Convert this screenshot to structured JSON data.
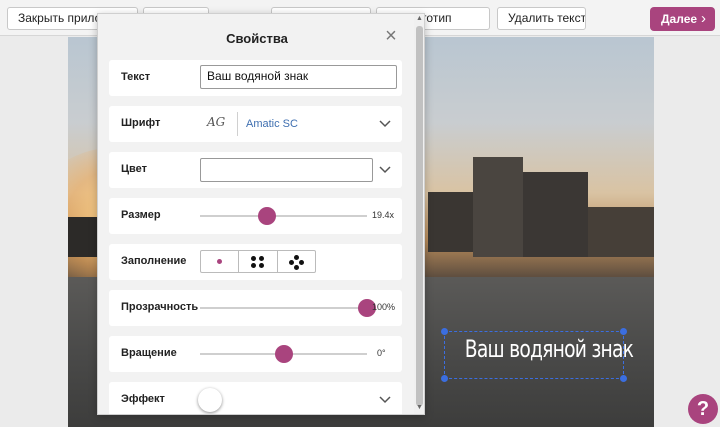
{
  "toolbar": {
    "close_app_label": "Закрыть прилож",
    "hidden_button_2": "",
    "hidden_button_3": "",
    "add_logo_label": "ать логотип",
    "delete_text_label": "Удалить текст",
    "next_label": "Далее"
  },
  "watermark": {
    "text": "Ваш водяной знак"
  },
  "panel": {
    "title": "Свойства",
    "text": {
      "label": "Текст",
      "value": "Ваш водяной знак"
    },
    "font": {
      "label": "Шрифт",
      "preview": "AG",
      "name": "Amatic SC"
    },
    "color": {
      "label": "Цвет"
    },
    "size": {
      "label": "Размер",
      "value_text": "19.4x",
      "fraction": 0.4
    },
    "fill": {
      "label": "Заполнение"
    },
    "opacity": {
      "label": "Прозрачность",
      "value_text": "100%",
      "fraction": 1.0
    },
    "rotation": {
      "label": "Вращение",
      "value_text": "0°",
      "fraction": 0.5
    },
    "effect": {
      "label": "Эффект"
    }
  },
  "help": {
    "label": "?"
  },
  "colors": {
    "accent": "#a9447e",
    "selection": "#3b6ee0",
    "link": "#3f6fb0"
  }
}
